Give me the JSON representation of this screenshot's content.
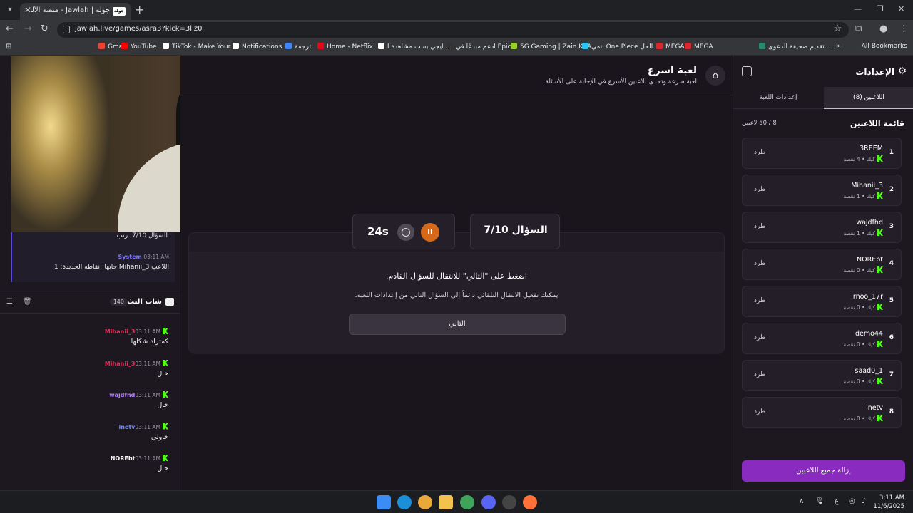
{
  "browser": {
    "tab_title": "جولة | Jawlah - منصة الألعاب الت...",
    "tab_favicon_text": "جولة",
    "url": "jawlah.live/games/asra3?kick=3liz0",
    "bookmarks": [
      {
        "label": "Gmail",
        "color": "#ea4335"
      },
      {
        "label": "YouTube",
        "color": "#ff0000"
      },
      {
        "label": "TikTok - Make Your...",
        "color": "#ffffff"
      },
      {
        "label": "Notifications",
        "color": "#ffffff"
      },
      {
        "label": "ترجمة",
        "color": "#4285f4"
      },
      {
        "label": "Home - Netflix",
        "color": "#e50914"
      },
      {
        "label": "ايجي بست مشاهدة ا...",
        "color": "#ffffff"
      },
      {
        "label": "ادعم مبدعًا في Epic",
        "color": "#333333"
      },
      {
        "label": "5G Gaming | Zain KSA",
        "color": "#9acd32"
      },
      {
        "label": "انمي One Piece الحل...",
        "color": "#2ec4f0"
      },
      {
        "label": "MEGA",
        "color": "#d9272e"
      },
      {
        "label": "MEGA",
        "color": "#d9272e"
      },
      {
        "label": "تقديم صحيفة الدعوى...",
        "color": "#2b8a6e"
      }
    ],
    "all_bookmarks": "All Bookmarks"
  },
  "page": {
    "title": "لعبة اسرع",
    "subtitle": "لعبة سرعة وتحدي للاعبين الأسرع في الإجابة على الأسئلة"
  },
  "game": {
    "question_label": "السؤال 7/10",
    "timer": "24s",
    "pause_symbol": "II",
    "notice_main": "اضغط على \"التالي\" للانتقال للسؤال القادم.",
    "notice_sub": "يمكنك تفعيل الانتقال التلقائي دائماً إلى السؤال التالي من إعدادات اللعبة.",
    "next_label": "التالي"
  },
  "chat": {
    "system_msg_1": "السؤال 7/10: رتب",
    "system_name": "System",
    "system_time": "03:11 AM",
    "system_msg_2": "اللاعب Mihanii_3 جابها! نقاطه الجديدة: 1",
    "title": "شات البث",
    "count": "140",
    "messages": [
      {
        "name": "Mihanii_3",
        "time": "03:11 AM",
        "text": "كمثراة شكلها",
        "color": "#e0305a"
      },
      {
        "name": "Mihanii_3",
        "time": "03:11 AM",
        "text": "خال",
        "color": "#e0305a"
      },
      {
        "name": "wajdfhd",
        "time": "03:11 AM",
        "text": "خال",
        "color": "#b27cff"
      },
      {
        "name": "inetv",
        "time": "03:11 AM",
        "text": "خاولي",
        "color": "#6e8bff"
      },
      {
        "name": "NOREbt",
        "time": "03:11 AM",
        "text": "خال",
        "color": "#ffffff"
      }
    ]
  },
  "settings": {
    "title": "الإعدادات",
    "tab_players": "اللاعبين (8)",
    "tab_game": "إعدادات اللعبة",
    "players_title": "قائمة اللاعبين",
    "players_count": "8 / 50 لاعبين",
    "kick_label": "طرد",
    "platform": "كيك",
    "players": [
      {
        "rank": "1",
        "name": "3REEM",
        "points": "4 نقطة"
      },
      {
        "rank": "2",
        "name": "Mihanii_3",
        "points": "1 نقطة"
      },
      {
        "rank": "3",
        "name": "wajdfhd",
        "points": "1 نقطة"
      },
      {
        "rank": "4",
        "name": "NOREbt",
        "points": "0 نقطة"
      },
      {
        "rank": "5",
        "name": "rnoo_17r",
        "points": "0 نقطة"
      },
      {
        "rank": "6",
        "name": "demo44",
        "points": "0 نقطة"
      },
      {
        "rank": "7",
        "name": "saad0_1",
        "points": "0 نقطة"
      },
      {
        "rank": "8",
        "name": "inetv",
        "points": "0 نقطة"
      }
    ],
    "remove_all": "إزالة جميع اللاعبين"
  },
  "taskbar": {
    "time": "3:11 AM",
    "date": "11/6/2025",
    "lang": "ع"
  }
}
